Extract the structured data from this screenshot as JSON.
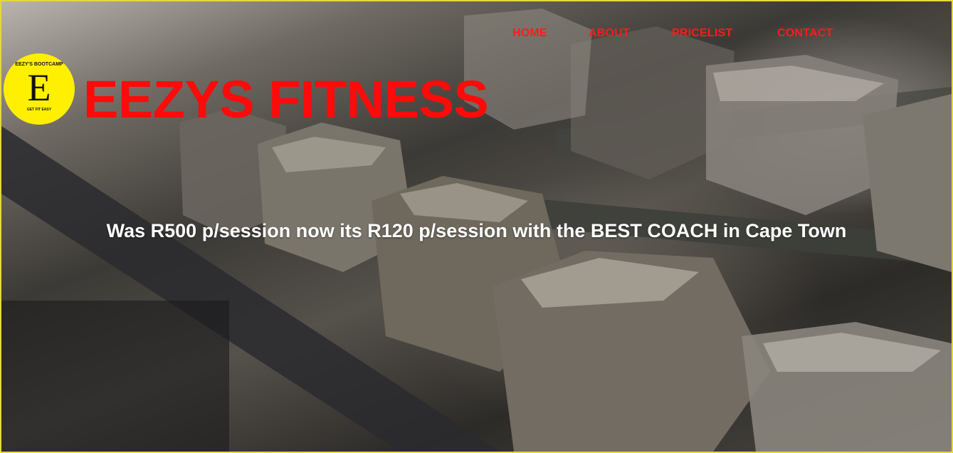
{
  "nav": {
    "items": [
      {
        "label": "HOME"
      },
      {
        "label": "ABOUT"
      },
      {
        "label": "PRICELIST"
      },
      {
        "label": "CONTACT"
      }
    ]
  },
  "logo": {
    "top_text": "EEZY'S BOOTCAMP",
    "mark": "E",
    "bottom_text": "GET FIT EASY"
  },
  "header": {
    "brand_title": "EEZYS FITNESS"
  },
  "hero": {
    "promo_text": "Was R500 p/session now its R120 p/session with the BEST COACH in Cape Town",
    "image": "dumbbell-rack-photo"
  },
  "colors": {
    "accent": "#ff0a0a",
    "logo_bg": "#ffef00",
    "frame_border": "#e6d83a",
    "promo_text": "#ffffff"
  }
}
